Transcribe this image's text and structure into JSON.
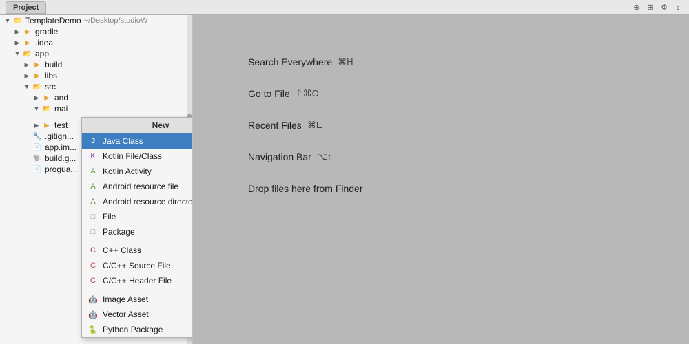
{
  "titlebar": {
    "tab_label": "Project",
    "icons": [
      "⊕",
      "⊞",
      "⚙",
      "↕"
    ]
  },
  "filetree": {
    "root_label": "TemplateDemo",
    "root_path": "~/Desktop/studioW",
    "items": [
      {
        "id": "gradle",
        "label": "gradle",
        "type": "folder",
        "depth": 1,
        "expanded": false
      },
      {
        "id": "idea",
        "label": ".idea",
        "type": "folder",
        "depth": 1,
        "expanded": false
      },
      {
        "id": "app",
        "label": "app",
        "type": "folder",
        "depth": 1,
        "expanded": true
      },
      {
        "id": "build",
        "label": "build",
        "type": "folder",
        "depth": 2,
        "expanded": false
      },
      {
        "id": "libs",
        "label": "libs",
        "type": "folder",
        "depth": 2,
        "expanded": false
      },
      {
        "id": "src",
        "label": "src",
        "type": "folder",
        "depth": 2,
        "expanded": true
      },
      {
        "id": "and",
        "label": "and",
        "type": "folder",
        "depth": 3,
        "expanded": false
      },
      {
        "id": "mai",
        "label": "mai",
        "type": "folder",
        "depth": 3,
        "expanded": true
      },
      {
        "id": "test",
        "label": "test",
        "type": "folder",
        "depth": 3,
        "expanded": false
      },
      {
        "id": "gitignore_app",
        "label": ".gitign...",
        "type": "file",
        "depth": 2
      },
      {
        "id": "app_iml",
        "label": "app.im...",
        "type": "file",
        "depth": 2
      },
      {
        "id": "build_g",
        "label": "build.g...",
        "type": "file",
        "depth": 2
      },
      {
        "id": "proguard",
        "label": "progua...",
        "type": "file",
        "depth": 2
      }
    ]
  },
  "context_menu": {
    "header": "New",
    "items": [
      {
        "id": "java-class",
        "label": "Java Class",
        "icon_type": "java",
        "selected": true
      },
      {
        "id": "kotlin-file",
        "label": "Kotlin File/Class",
        "icon_type": "kotlin"
      },
      {
        "id": "kotlin-activity",
        "label": "Kotlin Activity",
        "icon_type": "android"
      },
      {
        "id": "android-resource-file",
        "label": "Android resource file",
        "icon_type": "android"
      },
      {
        "id": "android-resource-dir",
        "label": "Android resource directory",
        "icon_type": "android"
      },
      {
        "id": "file",
        "label": "File",
        "icon_type": "file"
      },
      {
        "id": "package",
        "label": "Package",
        "icon_type": "file"
      },
      {
        "id": "cpp-class",
        "label": "C++ Class",
        "icon_type": "cpp",
        "separator_before": true
      },
      {
        "id": "cpp-source",
        "label": "C/C++ Source File",
        "icon_type": "cpp"
      },
      {
        "id": "cpp-header",
        "label": "C/C++ Header File",
        "icon_type": "cpp"
      },
      {
        "id": "image-asset",
        "label": "Image Asset",
        "icon_type": "image",
        "separator_before": true
      },
      {
        "id": "vector-asset",
        "label": "Vector Asset",
        "icon_type": "vector"
      },
      {
        "id": "python-package",
        "label": "Python Package",
        "icon_type": "python"
      }
    ]
  },
  "right_panel": {
    "shortcuts": [
      {
        "label": "Search Everywhere",
        "key": "⌘H"
      },
      {
        "label": "Go to File",
        "key": "⇧⌘O"
      },
      {
        "label": "Recent Files",
        "key": "⌘E"
      },
      {
        "label": "Navigation Bar",
        "key": "⌥↑"
      },
      {
        "label": "Drop files here from Finder",
        "key": ""
      }
    ]
  }
}
